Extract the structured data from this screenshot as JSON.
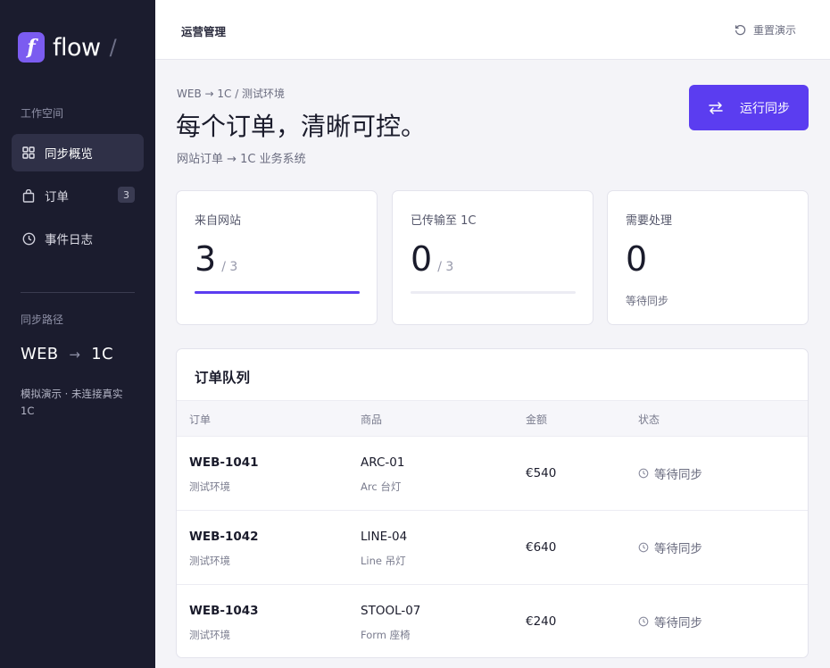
{
  "sidebar": {
    "logo_mark": "f",
    "logo_text": "flow",
    "logo_slash": "/",
    "workspace_label": "工作空间",
    "nav": [
      {
        "label": "同步概览",
        "icon": "grid-icon",
        "active": true
      },
      {
        "label": "订单",
        "icon": "bag-icon",
        "badge": "3"
      },
      {
        "label": "事件日志",
        "icon": "clock-icon"
      }
    ],
    "route_label": "同步路径",
    "route_from": "WEB",
    "route_arrow": "→",
    "route_to": "1C",
    "note": "模拟演示 · 未连接真实 1C"
  },
  "topbar": {
    "title": "运营管理",
    "reset_label": "重置演示"
  },
  "header": {
    "breadcrumb": "WEB → 1C / 测试环境",
    "title": "每个订单，清晰可控。",
    "subtitle": "网站订单 → 1C 业务系统",
    "run_button": "运行同步"
  },
  "stats": [
    {
      "label": "来自网站",
      "value": "3",
      "of": "/ 3",
      "progress": 1.0
    },
    {
      "label": "已传输至 1C",
      "value": "0",
      "of": "/ 3",
      "progress": 0.0
    },
    {
      "label": "需要处理",
      "value": "0",
      "note": "等待同步"
    }
  ],
  "queue": {
    "title": "订单队列",
    "columns": [
      "订单",
      "商品",
      "金额",
      "状态"
    ],
    "rows": [
      {
        "order": "WEB-1041",
        "env": "测试环境",
        "sku": "ARC-01",
        "product": "Arc 台灯",
        "amount": "€540",
        "status": "等待同步"
      },
      {
        "order": "WEB-1042",
        "env": "测试环境",
        "sku": "LINE-04",
        "product": "Line 吊灯",
        "amount": "€640",
        "status": "等待同步"
      },
      {
        "order": "WEB-1043",
        "env": "测试环境",
        "sku": "STOOL-07",
        "product": "Form 座椅",
        "amount": "€240",
        "status": "等待同步"
      }
    ]
  },
  "colors": {
    "accent": "#5b3df0",
    "logo": "#7b5cf0",
    "sidebar_bg": "#1b1c2e"
  }
}
